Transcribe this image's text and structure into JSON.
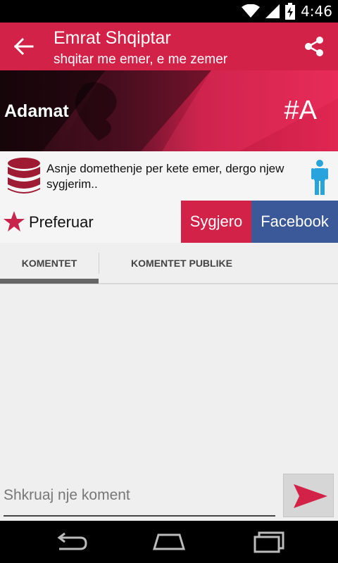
{
  "status_bar": {
    "time": "4:46",
    "icons": [
      "wifi-icon",
      "signal-icon",
      "battery-charging-icon"
    ]
  },
  "app_bar": {
    "title": "Emrat Shqiptar",
    "subtitle": "shqitar me emer, e me zemer",
    "back_icon": "arrow-left-icon",
    "share_icon": "share-icon"
  },
  "banner": {
    "name": "Adamat",
    "letter": "#A"
  },
  "info": {
    "text": "Asnje domethenje per kete emer, dergo njew sygjerim..",
    "icons": [
      "database-icon",
      "person-icon"
    ]
  },
  "actions": {
    "favorite_label": "Preferuar",
    "suggest_label": "Sygjero",
    "facebook_label": "Facebook"
  },
  "tabs": [
    {
      "label": "KOMENTET",
      "selected": true
    },
    {
      "label": "KOMENTET PUBLIKE",
      "selected": false
    }
  ],
  "comment": {
    "placeholder": "Shkruaj nje koment",
    "value": ""
  },
  "colors": {
    "primary": "#d22248",
    "facebook": "#3b5998",
    "person_icon": "#29a3db"
  }
}
